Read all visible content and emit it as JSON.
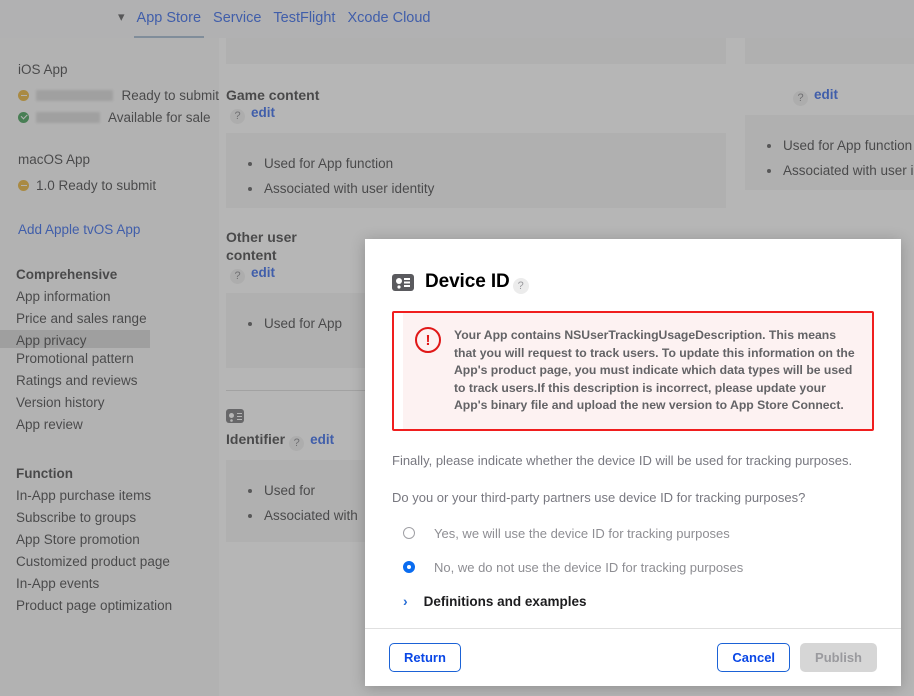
{
  "tabbar": {
    "chevron_icon": "chevron-down-icon",
    "tabs": [
      {
        "label": "App Store",
        "active": true
      },
      {
        "label": "Service",
        "active": false
      },
      {
        "label": "TestFlight",
        "active": false
      },
      {
        "label": "Xcode Cloud",
        "active": false
      }
    ]
  },
  "sidebar": {
    "platforms": [
      {
        "title": "iOS App",
        "versions": [
          {
            "status_color": "#e3a410",
            "status_icon": "amber-dot-icon",
            "version": "",
            "label": "Ready to submit",
            "redacted": true,
            "redact_width": 78
          },
          {
            "status_color": "#1a8b33",
            "status_icon": "green-check-icon",
            "version": "",
            "label": "Available for sale",
            "redacted": true,
            "redact_width": 64
          }
        ]
      },
      {
        "title": "macOS App",
        "versions": [
          {
            "status_color": "#e3a410",
            "status_icon": "amber-dot-icon",
            "version": "1.0",
            "label": "Ready to submit",
            "redacted": false,
            "redact_width": 0
          }
        ]
      }
    ],
    "add_tvos_link": "Add Apple tvOS App",
    "sections": [
      {
        "title": "Comprehensive",
        "items": [
          {
            "label": "App information",
            "selected": false
          },
          {
            "label": "Price and sales range",
            "selected": false
          },
          {
            "label": "App privacy",
            "selected": true
          },
          {
            "label": "Promotional pattern",
            "selected": false
          },
          {
            "label": "Ratings and reviews",
            "selected": false
          },
          {
            "label": "Version history",
            "selected": false
          },
          {
            "label": "App review",
            "selected": false
          }
        ]
      },
      {
        "title": "Function",
        "items": [
          {
            "label": "In-App purchase items",
            "selected": false
          },
          {
            "label": "Subscribe to groups",
            "selected": false
          },
          {
            "label": "App Store promotion",
            "selected": false
          },
          {
            "label": "Customized product page",
            "selected": false
          },
          {
            "label": "In-App events",
            "selected": false
          },
          {
            "label": "Product page optimization",
            "selected": false
          }
        ]
      }
    ]
  },
  "content": {
    "help_glyph": "?",
    "edit_label": "edit",
    "column_a": [
      {
        "heading": "Game content",
        "has_icon": false,
        "divider_before": false,
        "bullets": [
          "Used for App function",
          "Associated with user identity"
        ],
        "body_height": 75
      },
      {
        "heading": "Other user content",
        "has_icon": false,
        "divider_before": false,
        "bullets": [
          "Used for App"
        ],
        "body_height": 75
      },
      {
        "heading": "Identifier",
        "has_icon": true,
        "icon_name": "contact-card-icon",
        "divider_before": true,
        "bullets": [
          "Used for",
          "Associated with"
        ],
        "body_height": 75
      }
    ],
    "column_b": [
      {
        "heading": "",
        "has_icon": false,
        "divider_before": false,
        "bullets": [
          "Used for App function",
          "Associated with user identity"
        ],
        "body_height": 75
      }
    ]
  },
  "modal": {
    "icon_name": "contact-card-icon",
    "title": "Device ID",
    "title_help_glyph": "?",
    "alert": {
      "icon_name": "exclamation-circle-icon",
      "icon_glyph": "!",
      "text": "Your App contains NSUserTrackingUsageDescription. This means that you will request to track users. To update this information on the App's product page, you must indicate which data types will be used to track users.If this description is incorrect, please update your App's binary file and upload the new version to App Store Connect.",
      "border_color": "#f01e1e",
      "fill_color": "#fdf2f2"
    },
    "intro_text": "Finally, please indicate whether the device ID will be used for tracking purposes.",
    "question_text": "Do you or your third-party partners use device ID for tracking purposes?",
    "options": [
      {
        "label": "Yes, we will use the device ID for tracking purposes",
        "checked": false
      },
      {
        "label": "No, we do not use the device ID for tracking purposes",
        "checked": true
      }
    ],
    "disclosure": {
      "chevron_icon": "chevron-right-icon",
      "label": "Definitions and examples"
    },
    "footer": {
      "return_label": "Return",
      "cancel_label": "Cancel",
      "publish_label": "Publish",
      "publish_disabled": true
    }
  },
  "colors": {
    "link": "#0a47e6",
    "accent_blue": "#0a6cf0",
    "alert_red": "#f01e1e",
    "status_amber": "#e3a410",
    "status_green": "#1a8b33",
    "scrim": "rgba(115,115,115,0.52)"
  }
}
